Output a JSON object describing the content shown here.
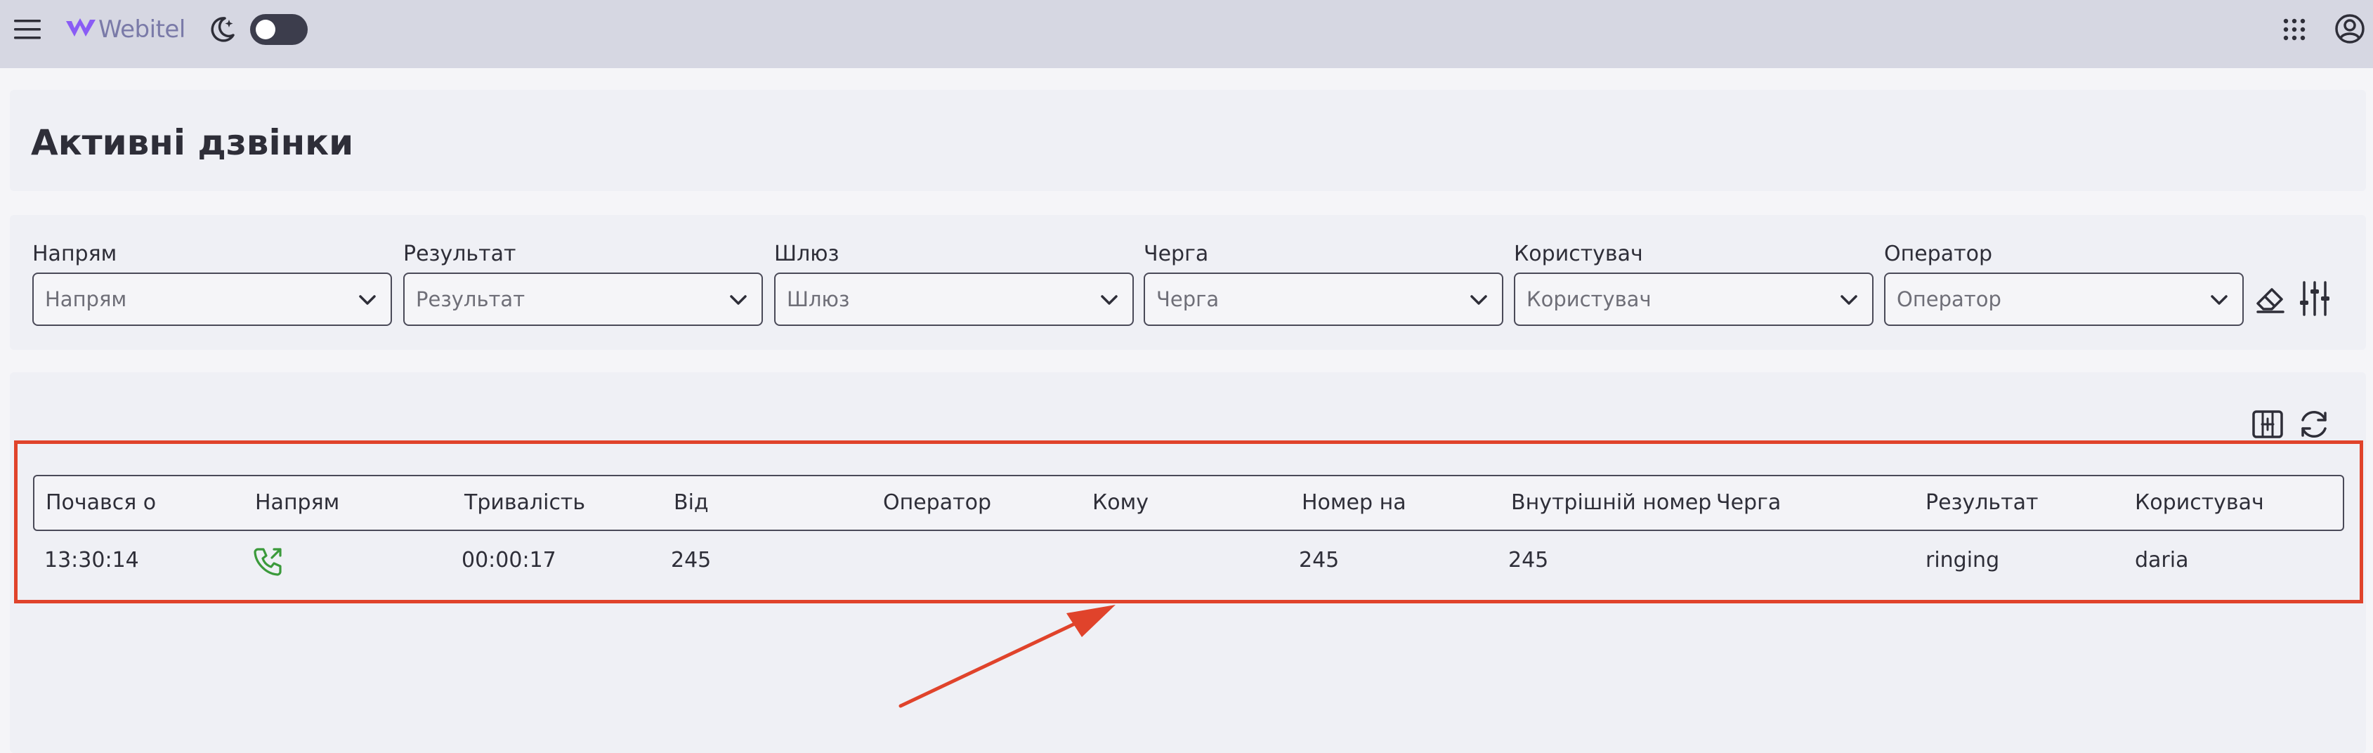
{
  "header": {
    "logo_text": "Webitel",
    "icons": {
      "menu": "hamburger-icon",
      "theme": "moon-icon",
      "apps": "apps-grid-icon",
      "account": "account-icon"
    },
    "theme_toggle_on": false
  },
  "page": {
    "title": "Активні дзвінки"
  },
  "filters": [
    {
      "label": "Напрям",
      "placeholder": "Напрям"
    },
    {
      "label": "Результат",
      "placeholder": "Результат"
    },
    {
      "label": "Шлюз",
      "placeholder": "Шлюз"
    },
    {
      "label": "Черга",
      "placeholder": "Черга"
    },
    {
      "label": "Користувач",
      "placeholder": "Користувач"
    },
    {
      "label": "Оператор",
      "placeholder": "Оператор"
    }
  ],
  "filter_actions": {
    "reset_icon": "eraser-icon",
    "settings_icon": "sliders-icon"
  },
  "table_actions": {
    "columns_icon": "columns-icon",
    "refresh_icon": "refresh-icon"
  },
  "table": {
    "columns": [
      "Почався о",
      "Напрям",
      "Тривалість",
      "Від",
      "Оператор",
      "Кому",
      "Номер на",
      "Внутрішній номер",
      "Черга",
      "Результат",
      "Користувач"
    ],
    "rows": [
      {
        "started_at": "13:30:14",
        "direction_icon": "outbound-call-icon",
        "duration": "00:00:17",
        "from": "245",
        "operator": "",
        "to": "",
        "number_on": "245",
        "extension": "245",
        "queue": "",
        "result": "ringing",
        "user": "daria"
      }
    ]
  },
  "colors": {
    "header_bg": "#d6d7e2",
    "page_bg": "#f5f5f8",
    "panel_bg": "#eff0f5",
    "text": "#2e2e38",
    "logo_accent": "#8a5cf5",
    "call_icon": "#3b9a3b",
    "annotation": "#e0432b"
  }
}
